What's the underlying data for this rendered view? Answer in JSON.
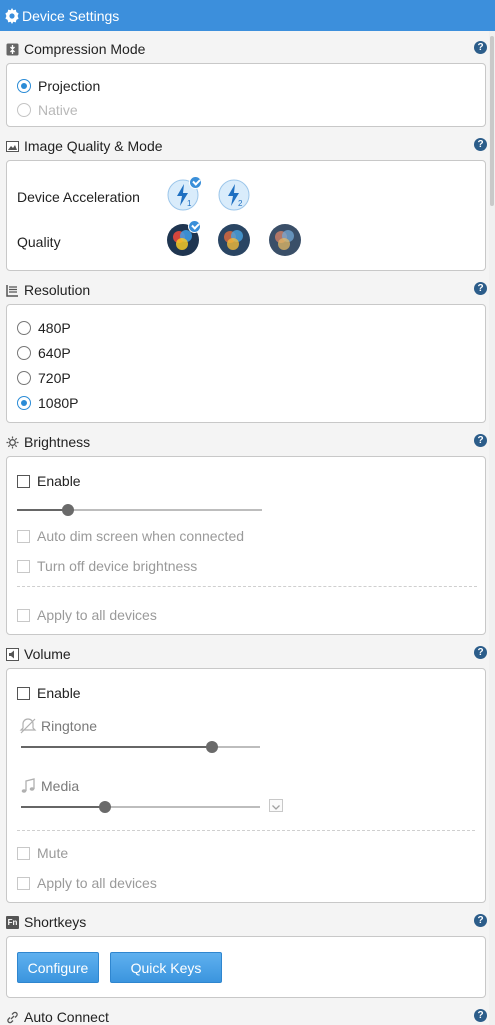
{
  "title": "Device Settings",
  "colors": {
    "accent": "#3c8fdc",
    "check": "#2a8bd6",
    "help": "#2c5d8a"
  },
  "compression": {
    "title": "Compression Mode",
    "options": [
      {
        "label": "Projection",
        "selected": true
      },
      {
        "label": "Native",
        "selected": false,
        "disabled": true
      }
    ]
  },
  "image_quality": {
    "title": "Image Quality & Mode",
    "acceleration_label": "Device Acceleration",
    "acceleration_levels": [
      "1",
      "2"
    ],
    "acceleration_selected": 1,
    "quality_label": "Quality",
    "quality_selected": 1
  },
  "resolution": {
    "title": "Resolution",
    "options": [
      {
        "label": "480P",
        "selected": false
      },
      {
        "label": "640P",
        "selected": false
      },
      {
        "label": "720P",
        "selected": false
      },
      {
        "label": "1080P",
        "selected": true
      }
    ]
  },
  "brightness": {
    "title": "Brightness",
    "enable_label": "Enable",
    "enabled": false,
    "level_fraction": 0.21,
    "auto_dim_label": "Auto dim screen when connected",
    "turn_off_label": "Turn off device brightness",
    "apply_all_label": "Apply to all devices"
  },
  "volume": {
    "title": "Volume",
    "enable_label": "Enable",
    "enabled": false,
    "ringtone_label": "Ringtone",
    "ringtone_fraction": 0.8,
    "media_label": "Media",
    "media_fraction": 0.35,
    "mute_label": "Mute",
    "apply_all_label": "Apply to all devices"
  },
  "shortkeys": {
    "title": "Shortkeys",
    "icon_text": "Fn",
    "configure_label": "Configure",
    "quick_keys_label": "Quick Keys"
  },
  "auto_connect": {
    "title": "Auto Connect"
  },
  "icons": {
    "title": "gear-icon",
    "compression": "compress-icon",
    "image_quality": "image-icon",
    "resolution": "resolution-icon",
    "brightness": "sun-icon",
    "volume": "speaker-icon",
    "shortkeys": "fn-key-icon",
    "auto_connect": "link-icon",
    "help": "help-icon",
    "ringtone": "bell-muted-icon",
    "media": "music-note-icon",
    "media_dropdown": "chevron-down-icon"
  }
}
